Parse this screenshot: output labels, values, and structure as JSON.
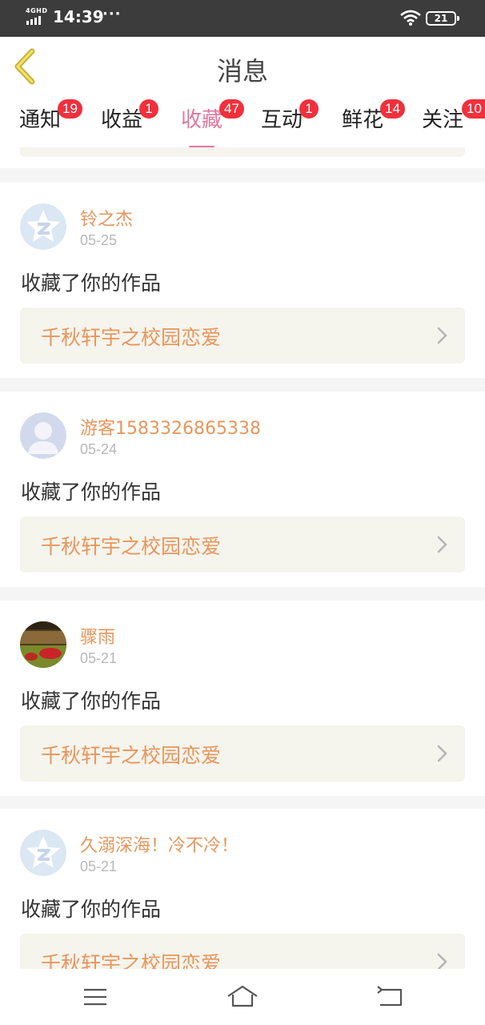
{
  "status_bar": {
    "network": "4GHD",
    "time": "14:39",
    "dots": "···",
    "battery": "21"
  },
  "header": {
    "title": "消息"
  },
  "tabs": [
    {
      "label": "通知",
      "badge": "19"
    },
    {
      "label": "收益",
      "badge": "1"
    },
    {
      "label": "收藏",
      "badge": "47",
      "active": true
    },
    {
      "label": "互动",
      "badge": "1"
    },
    {
      "label": "鲜花",
      "badge": "14"
    },
    {
      "label": "关注",
      "badge": "10"
    }
  ],
  "items": [
    {
      "username": "铃之杰",
      "date": "05-25",
      "action": "收藏了你的作品",
      "work_title": "千秋轩宇之校园恋爱",
      "avatar": "default-avatar-icon"
    },
    {
      "username": "游客1583326865338",
      "date": "05-24",
      "action": "收藏了你的作品",
      "work_title": "千秋轩宇之校园恋爱",
      "avatar": "guest-avatar-icon"
    },
    {
      "username": "骤雨",
      "date": "05-21",
      "action": "收藏了你的作品",
      "work_title": "千秋轩宇之校园恋爱",
      "avatar": "photo-avatar"
    },
    {
      "username": "久溺深海！冷不冷！",
      "date": "05-21",
      "action": "收藏了你的作品",
      "work_title": "千秋轩宇之校园恋爱",
      "avatar": "default-avatar-icon"
    }
  ],
  "colors": {
    "accent": "#e0779c",
    "name_orange": "#e8965c",
    "badge_red": "#f0303c",
    "card_bg": "#f5f4ed"
  }
}
